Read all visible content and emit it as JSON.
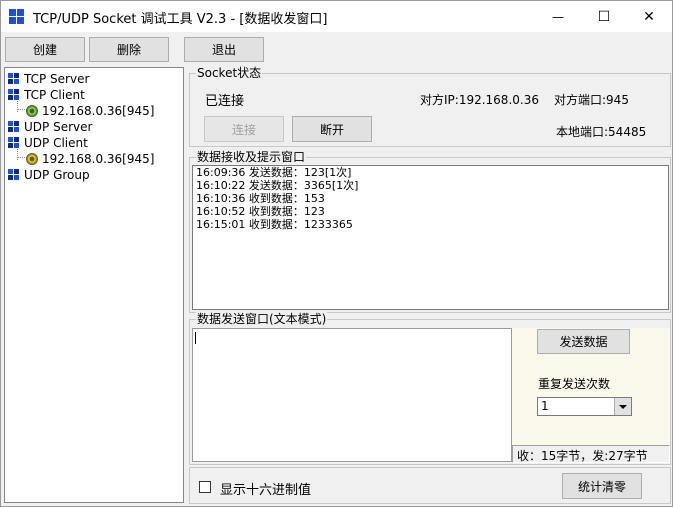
{
  "window": {
    "title": "TCP/UDP Socket 调试工具 V2.3 - [数据收发窗口]",
    "minimize_glyph": "—",
    "maximize_glyph": "☐",
    "close_glyph": "✕"
  },
  "toolbar": {
    "create_label": "创建",
    "delete_label": "删除",
    "exit_label": "退出"
  },
  "tree": {
    "tcp_server": "TCP Server",
    "tcp_client": "TCP Client",
    "tcp_client_conn": "192.168.0.36[945]",
    "udp_server": "UDP Server",
    "udp_client": "UDP Client",
    "udp_client_conn": "192.168.0.36[945]",
    "udp_group": "UDP Group"
  },
  "socket_status": {
    "group_title": "Socket状态",
    "state": "已连接",
    "peer_ip": "对方IP:192.168.0.36",
    "peer_port": "对方端口:945",
    "local_port": "本地端口:54485",
    "connect_label": "连接",
    "disconnect_label": "断开"
  },
  "receive": {
    "group_title": "数据接收及提示窗口",
    "lines": [
      "16:09:36 发送数据：123[1次]",
      "16:10:22 发送数据：3365[1次]",
      "16:10:36 收到数据：153",
      "16:10:52 收到数据：123",
      "16:15:01 收到数据：1233365"
    ]
  },
  "send": {
    "group_title": "数据发送窗口(文本模式)",
    "input_value": "",
    "send_button_label": "发送数据",
    "repeat_label": "重复发送次数",
    "repeat_value": "1",
    "stats": "收：15字节，发:27字节"
  },
  "footer": {
    "hex_checkbox_label": "显示十六进制值",
    "hex_checked": false,
    "clear_stats_label": "统计清零"
  },
  "colors": {
    "icon_blue": "#1f4fd8",
    "icon_dark_blue": "#0b2a8c",
    "app_icon_red": "#d02020",
    "app_icon_green": "#209030",
    "app_icon_yellow": "#e8c020",
    "status_dot_green": "#6aa830"
  }
}
